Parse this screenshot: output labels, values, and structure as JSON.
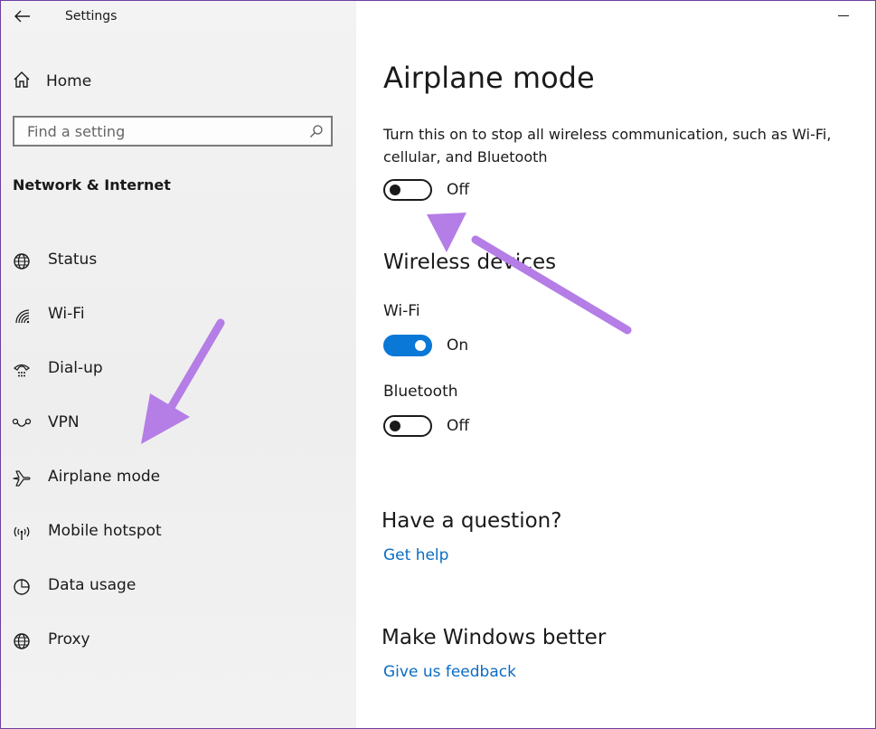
{
  "window": {
    "title": "Settings"
  },
  "sidebar": {
    "home_label": "Home",
    "search_placeholder": "Find a setting",
    "section_title": "Network & Internet",
    "items": [
      {
        "label": "Status",
        "icon": "globe-status-icon"
      },
      {
        "label": "Wi-Fi",
        "icon": "wifi-icon"
      },
      {
        "label": "Dial-up",
        "icon": "dialup-icon"
      },
      {
        "label": "VPN",
        "icon": "vpn-icon"
      },
      {
        "label": "Airplane mode",
        "icon": "airplane-icon"
      },
      {
        "label": "Mobile hotspot",
        "icon": "hotspot-icon"
      },
      {
        "label": "Data usage",
        "icon": "data-usage-icon"
      },
      {
        "label": "Proxy",
        "icon": "globe-icon"
      }
    ]
  },
  "main": {
    "title": "Airplane mode",
    "description": "Turn this on to stop all wireless communication, such as Wi-Fi, cellular, and Bluetooth",
    "airplane_toggle": {
      "state": "Off"
    },
    "wireless_heading": "Wireless devices",
    "wifi": {
      "label": "Wi-Fi",
      "state": "On"
    },
    "bluetooth": {
      "label": "Bluetooth",
      "state": "Off"
    },
    "question_heading": "Have a question?",
    "get_help": "Get help",
    "feedback_heading": "Make Windows better",
    "feedback_link": "Give us feedback"
  },
  "colors": {
    "accent": "#0a78d7",
    "link": "#0a6cc4",
    "annotation_arrow": "#b57de6"
  }
}
